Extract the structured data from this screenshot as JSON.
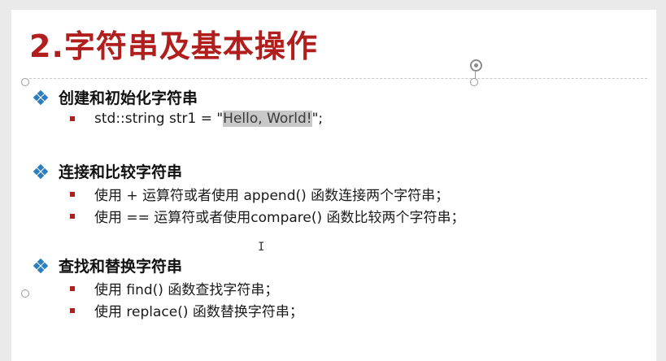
{
  "slide": {
    "title": "2.字符串及基本操作",
    "sections": [
      {
        "heading": "创建和初始化字符串",
        "items": [
          {
            "before": "std::string str1 = \"",
            "highlight": "Hello, World!",
            "after": "\";"
          }
        ]
      },
      {
        "heading": "连接和比较字符串",
        "items": [
          {
            "text": "使用 + 运算符或者使用 append() 函数连接两个字符串；"
          },
          {
            "text": "使用 == 运算符或者使用compare() 函数比较两个字符串；"
          }
        ]
      },
      {
        "heading": "查找和替换字符串",
        "items": [
          {
            "text": "使用 find() 函数查找字符串；"
          },
          {
            "text": "使用 replace() 函数替换字符串；"
          }
        ]
      }
    ]
  },
  "colors": {
    "title": "#b01e1e",
    "heading_bullet": "#2a7fc1",
    "sub_bullet": "#b01e1e",
    "selection_highlight": "#c8c8c8"
  },
  "icons": {
    "heading_bullet": "diamond-cluster-icon",
    "sub_bullet": "square-bullet-icon",
    "cursor": "text-cursor-icon",
    "rotate": "rotate-handle-icon"
  }
}
